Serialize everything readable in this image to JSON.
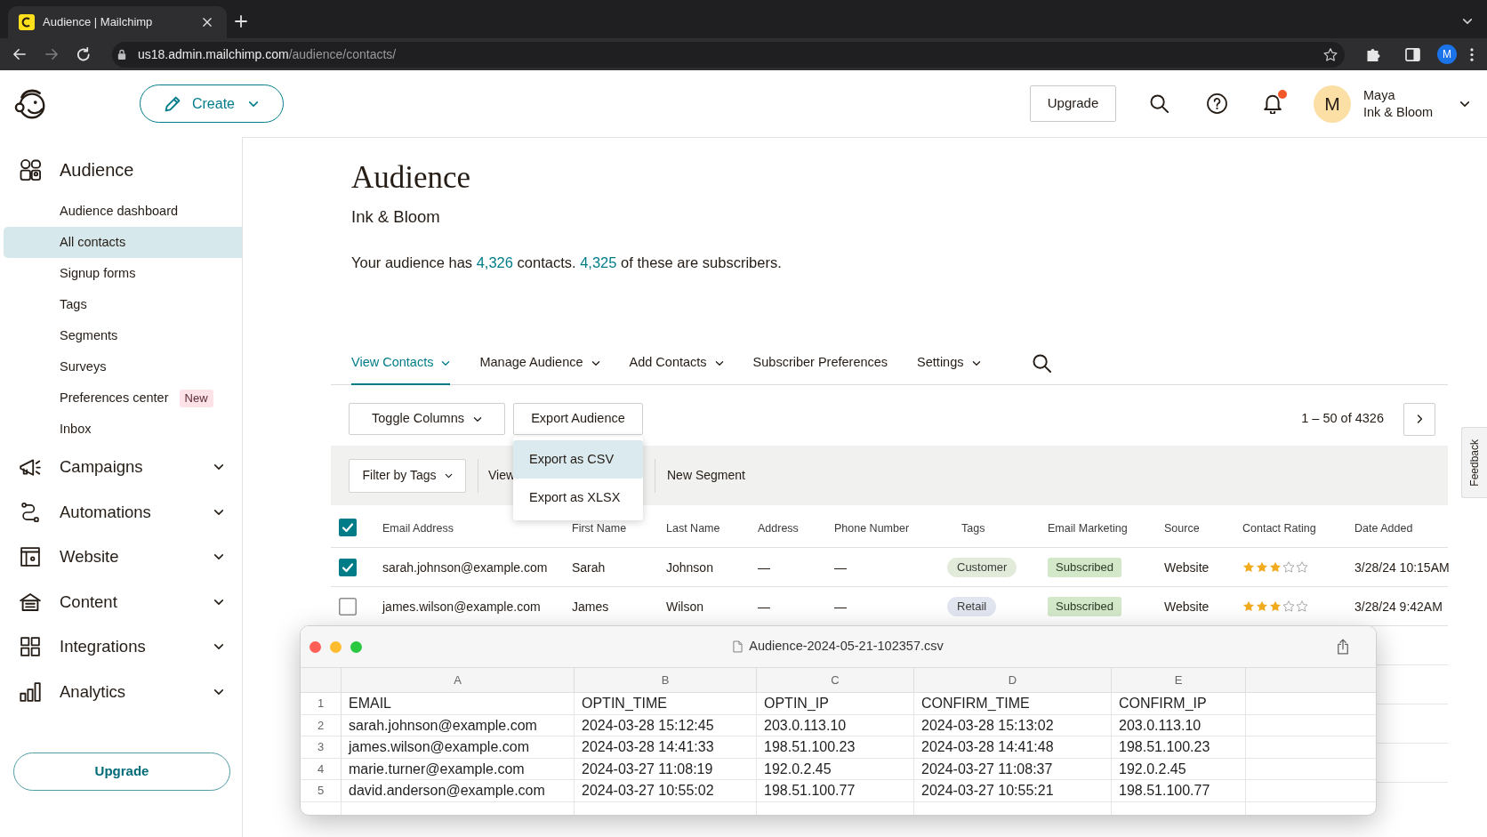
{
  "browser": {
    "tab_title": "Audience | Mailchimp",
    "url": {
      "host": "us18.admin.mailchimp.com",
      "path": "/audience/contacts/"
    },
    "profile_initial": "M"
  },
  "header": {
    "create_button": "Create",
    "upgrade_button": "Upgrade",
    "notifications_unread": true,
    "account": {
      "initial": "M",
      "name": "Maya",
      "organization": "Ink & Bloom"
    }
  },
  "sidebar": {
    "heading": "Audience",
    "items": [
      {
        "label": "Audience dashboard",
        "selected": false
      },
      {
        "label": "All contacts",
        "selected": true
      },
      {
        "label": "Signup forms",
        "selected": false
      },
      {
        "label": "Tags",
        "selected": false
      },
      {
        "label": "Segments",
        "selected": false
      },
      {
        "label": "Surveys",
        "selected": false
      },
      {
        "label": "Preferences center",
        "selected": false,
        "badge": "New"
      },
      {
        "label": "Inbox",
        "selected": false
      }
    ],
    "sections": [
      {
        "label": "Campaigns",
        "expanded": false
      },
      {
        "label": "Automations",
        "expanded": false
      },
      {
        "label": "Website",
        "expanded": false
      },
      {
        "label": "Content",
        "expanded": false
      },
      {
        "label": "Integrations",
        "expanded": false
      },
      {
        "label": "Analytics",
        "expanded": false
      }
    ],
    "upgrade_button": "Upgrade"
  },
  "page": {
    "title": "Audience",
    "subtitle": "Ink & Bloom",
    "summary": [
      {
        "kind": "text",
        "text": "Your audience has "
      },
      {
        "kind": "link",
        "text": "4,326"
      },
      {
        "kind": "text",
        "text": " contacts. "
      },
      {
        "kind": "link",
        "text": "4,325"
      },
      {
        "kind": "text",
        "text": " of these are subscribers."
      }
    ]
  },
  "tabs": [
    {
      "label": "View Contacts",
      "selected": true,
      "kind": "menu"
    },
    {
      "label": "Manage Audience",
      "selected": false,
      "kind": "menu"
    },
    {
      "label": "Add Contacts",
      "selected": false,
      "kind": "menu"
    },
    {
      "label": "Subscriber Preferences",
      "selected": false,
      "kind": "link"
    },
    {
      "label": "Settings",
      "selected": false,
      "kind": "menu"
    }
  ],
  "toolbar": {
    "toggle_columns": "Toggle Columns",
    "export_audience": "Export Audience",
    "range": "1 – 50 of 4326"
  },
  "export_menu": {
    "items": [
      {
        "label": "Export as CSV",
        "selected": true
      },
      {
        "label": "Export as XLSX",
        "selected": false
      }
    ]
  },
  "filter_bar": {
    "filter_by_tags": "Filter by Tags",
    "view": "View",
    "new_segment": "New Segment"
  },
  "table": {
    "all_checked": true,
    "columns": [
      "Email Address",
      "First Name",
      "Last Name",
      "Address",
      "Phone Number",
      "Tags",
      "Email Marketing",
      "Source",
      "Contact Rating",
      "Date Added"
    ],
    "rows": [
      {
        "checked": true,
        "email": "sarah.johnson@example.com",
        "first_name": "Sarah",
        "last_name": "Johnson",
        "address": "—",
        "phone": "—",
        "tag": {
          "label": "Customer",
          "color": "#e2ebd9"
        },
        "email_marketing": "Subscribed",
        "source": "Website",
        "stars": 3,
        "date_added": "3/28/24 10:15AM"
      },
      {
        "checked": false,
        "email": "james.wilson@example.com",
        "first_name": "James",
        "last_name": "Wilson",
        "address": "—",
        "phone": "—",
        "tag": {
          "label": "Retail",
          "color": "#e1e5ef"
        },
        "email_marketing": "Subscribed",
        "source": "Website",
        "stars": 3,
        "date_added": "3/28/24 9:42AM"
      }
    ]
  },
  "feedback_tab": "Feedback",
  "csv_window": {
    "title": "Audience-2024-05-21-102357.csv",
    "columns": [
      "A",
      "B",
      "C",
      "D",
      "E"
    ],
    "rows": [
      {
        "number": "1",
        "cells": [
          "EMAIL",
          "OPTIN_TIME",
          "OPTIN_IP",
          "CONFIRM_TIME",
          "CONFIRM_IP"
        ]
      },
      {
        "number": "2",
        "cells": [
          "sarah.johnson@example.com",
          "2024-03-28 15:12:45",
          "203.0.113.10",
          "2024-03-28 15:13:02",
          "203.0.113.10"
        ]
      },
      {
        "number": "3",
        "cells": [
          "james.wilson@example.com",
          "2024-03-28 14:41:33",
          "198.51.100.23",
          "2024-03-28 14:41:48",
          "198.51.100.23"
        ]
      },
      {
        "number": "4",
        "cells": [
          "marie.turner@example.com",
          "2024-03-27 11:08:19",
          "192.0.2.45",
          "2024-03-27 11:08:37",
          "192.0.2.45"
        ]
      },
      {
        "number": "5",
        "cells": [
          "david.anderson@example.com",
          "2024-03-27 10:55:02",
          "198.51.100.77",
          "2024-03-27 10:55:21",
          "198.51.100.77"
        ]
      }
    ]
  }
}
